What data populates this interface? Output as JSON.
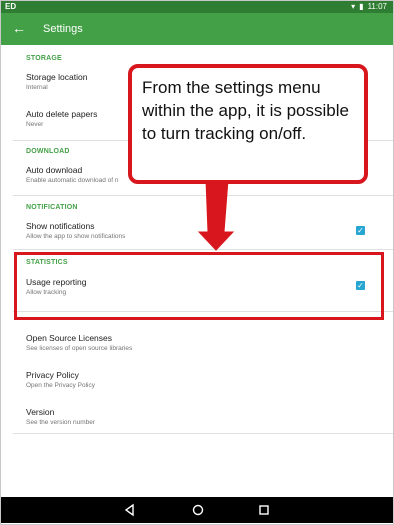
{
  "status_bar": {
    "left": "ED",
    "time": "11:07",
    "icons": [
      "wifi-icon",
      "battery-icon"
    ]
  },
  "app_bar": {
    "title": "Settings",
    "back_icon": "arrow-left-icon"
  },
  "sections": [
    {
      "header": "STORAGE",
      "items": [
        {
          "title": "Storage location",
          "subtitle": "Internal"
        },
        {
          "title": "Auto delete papers",
          "subtitle": "Never"
        }
      ]
    },
    {
      "header": "DOWNLOAD",
      "items": [
        {
          "title": "Auto download",
          "subtitle": "Enable automatic download of n"
        }
      ]
    },
    {
      "header": "NOTIFICATION",
      "items": [
        {
          "title": "Show notifications",
          "subtitle": "Allow the app to show notifications",
          "checked": true
        }
      ]
    },
    {
      "header": "STATISTICS",
      "items": [
        {
          "title": "Usage reporting",
          "subtitle": "Allow tracking",
          "checked": true
        }
      ]
    },
    {
      "header": "",
      "items": [
        {
          "title": "Open Source Licenses",
          "subtitle": "See licenses of open source libraries"
        },
        {
          "title": "Privacy Policy",
          "subtitle": "Open the Privacy Policy"
        },
        {
          "title": "Version",
          "subtitle": "See the version number"
        }
      ]
    }
  ],
  "annotation": {
    "text": "From the settings menu within the app, it is possible to turn tracking on/off."
  },
  "colors": {
    "status_bar": "#2e7d32",
    "app_bar": "#43a047",
    "accent": "#43a047",
    "checkbox": "#26a6d1",
    "annotation_red": "#d8161d"
  },
  "nav_bar": {
    "icons": [
      "back-triangle-icon",
      "home-circle-icon",
      "recents-square-icon"
    ]
  }
}
